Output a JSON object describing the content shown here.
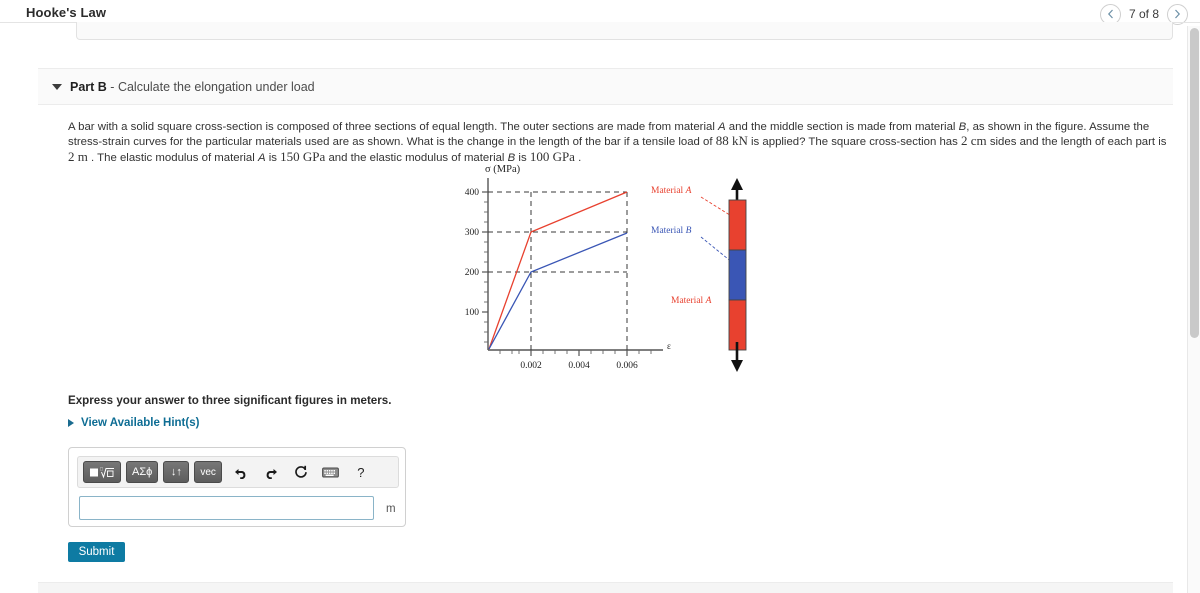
{
  "header": {
    "title": "Hooke's Law",
    "pager": {
      "prev_icon": "chevron-left-icon",
      "next_icon": "chevron-right-icon",
      "label": "7 of 8"
    }
  },
  "part": {
    "caret_icon": "caret-down-icon",
    "label": "Part B",
    "separator": " - ",
    "title": "Calculate the elongation under load"
  },
  "statement": {
    "s1": "A bar with a solid square cross-section is composed of three sections of equal length. The outer sections are made from material ",
    "matA1": "A",
    "s2": " and the middle section is made from material ",
    "matB1": "B",
    "s3": ", as shown in the figure. Assume the stress-strain curves for the particular materials used are as shown. What is the change in the length of the bar if a tensile load of ",
    "load": "88 kN",
    "s4": " is applied? The square cross-section has ",
    "side": "2 cm",
    "s5": " sides and the length of each part is ",
    "seg_len": "2 m",
    "s6": " . The elastic modulus of material ",
    "matA2": "A",
    "s7": " is ",
    "modA": "150 GPa",
    "s8": " and the elastic modulus of material ",
    "matB2": "B",
    "s9": " is ",
    "modB": "100 GPa",
    "s10": " ."
  },
  "chart_data": {
    "type": "line",
    "title": "",
    "xlabel": "ε",
    "ylabel": "σ  (MPa)",
    "xlim": [
      0,
      0.0072
    ],
    "ylim": [
      0,
      440
    ],
    "xticks": [
      0.002,
      0.004,
      0.006
    ],
    "xtick_labels": [
      "0.002",
      "0.004",
      "0.006"
    ],
    "yticks": [
      100,
      200,
      300,
      400
    ],
    "ytick_labels": [
      "100",
      "200",
      "300",
      "400"
    ],
    "grid": false,
    "guide_lines": [
      {
        "type": "h",
        "y": 400,
        "to_x": 0.006
      },
      {
        "type": "h",
        "y": 300,
        "to_x": 0.006
      },
      {
        "type": "h",
        "y": 200,
        "to_x": 0.006
      },
      {
        "type": "v",
        "x": 0.002,
        "to_y": 400
      },
      {
        "type": "v",
        "x": 0.006,
        "to_y": 400
      }
    ],
    "series": [
      {
        "name": "Material A",
        "color": "#e8412f",
        "label_position": "right-of-curve",
        "points": [
          {
            "x": 0,
            "y": 0
          },
          {
            "x": 0.002,
            "y": 300
          },
          {
            "x": 0.006,
            "y": 400
          }
        ]
      },
      {
        "name": "Material B",
        "color": "#3a56b5",
        "label_position": "right-of-curve",
        "points": [
          {
            "x": 0,
            "y": 0
          },
          {
            "x": 0.002,
            "y": 200
          },
          {
            "x": 0.006,
            "y": 297
          }
        ]
      }
    ],
    "legend": [
      "Material A",
      "Material B"
    ],
    "legend_position": "right"
  },
  "bar_diagram": {
    "top_arrow": "up-arrow-icon",
    "bottom_arrow": "down-arrow-icon",
    "segments": [
      {
        "material": "Material A",
        "color": "#e8412f"
      },
      {
        "material": "Material B",
        "color": "#3a56b5"
      },
      {
        "material": "Material A",
        "color": "#e8412f"
      }
    ],
    "callouts": [
      {
        "text": "Material A",
        "color": "#e8412f"
      },
      {
        "text": "Material B",
        "color": "#3a56b5"
      },
      {
        "text": "Material A",
        "color": "#e8412f"
      }
    ]
  },
  "answer": {
    "prompt": "Express your answer to three significant figures in meters.",
    "hints_caret": "caret-right-icon",
    "hints_label": "View Available Hint(s)",
    "toolbar": {
      "template_label": "■√□",
      "greek_label": "ΑΣϕ",
      "arrows_label": "↓↑",
      "vec_label": "vec",
      "undo_icon": "undo-icon",
      "redo_icon": "redo-icon",
      "reset_icon": "reset-icon",
      "keyboard_icon": "keyboard-icon",
      "help_icon": "help-icon",
      "help_label": "?"
    },
    "input_value": "",
    "input_placeholder": "",
    "unit": "m",
    "submit_label": "Submit"
  },
  "colors": {
    "accent": "#0e7ba3",
    "material_a": "#e8412f",
    "material_b": "#3a56b5",
    "link": "#0e6d94"
  }
}
